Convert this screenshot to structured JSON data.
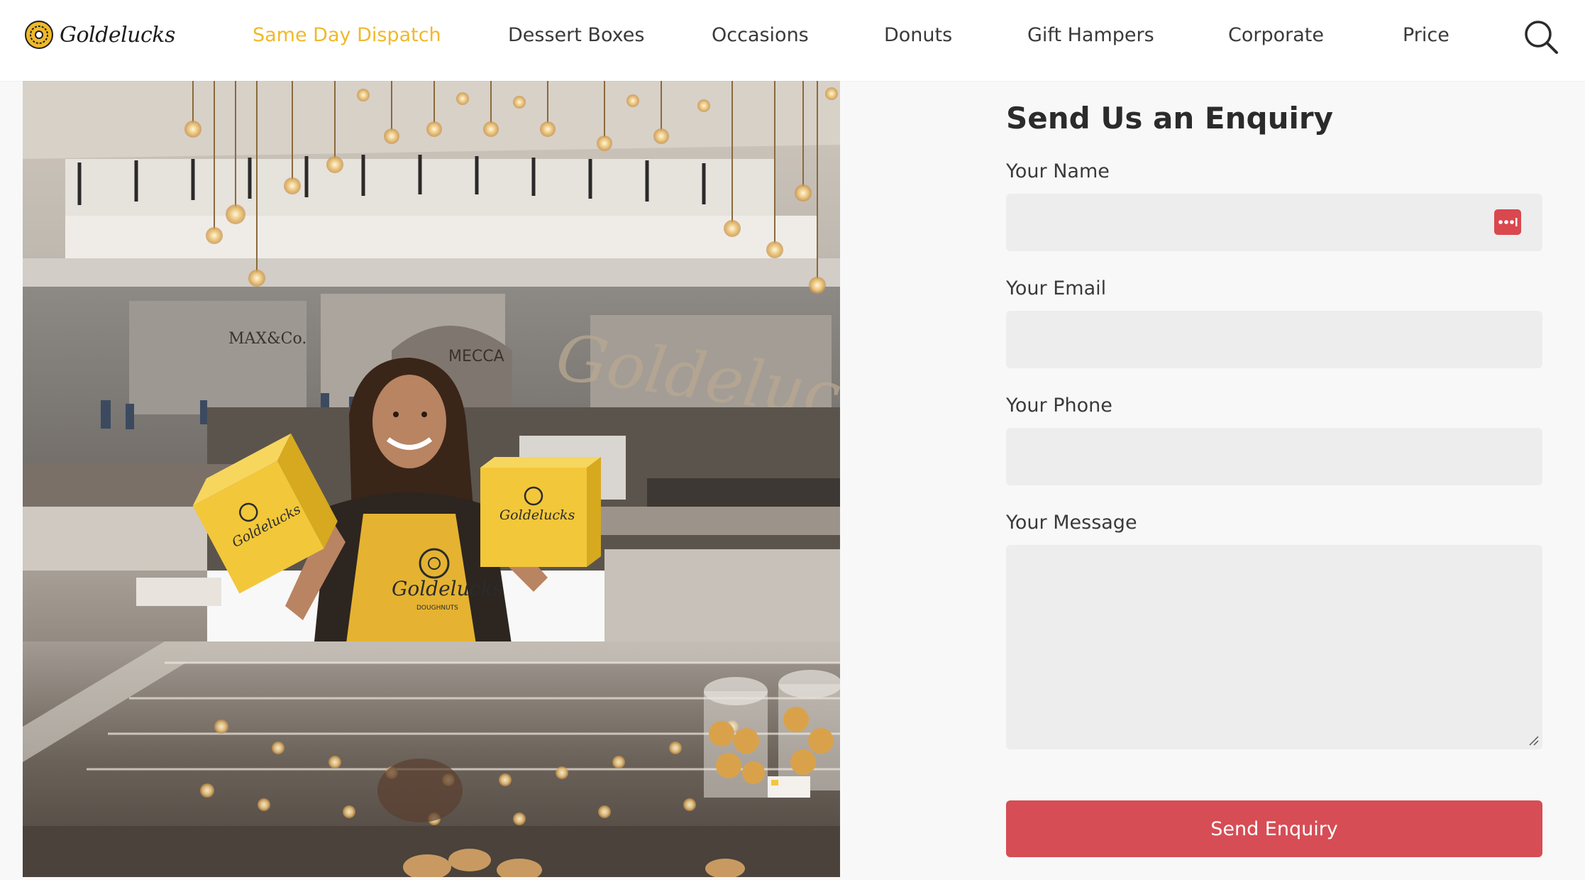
{
  "brand": {
    "name": "Goldelucks"
  },
  "nav": {
    "items": [
      {
        "label": "Same Day Dispatch",
        "active": true
      },
      {
        "label": "Dessert Boxes",
        "active": false
      },
      {
        "label": "Occasions",
        "active": false
      },
      {
        "label": "Donuts",
        "active": false
      },
      {
        "label": "Gift Hampers",
        "active": false
      },
      {
        "label": "Corporate",
        "active": false
      },
      {
        "label": "Price",
        "active": false
      }
    ],
    "search_icon": "search-icon"
  },
  "photo": {
    "box_brand": "Goldelucks",
    "apron_brand": "Goldelucks",
    "apron_sub": "DOUGHNUTS",
    "store_signs": [
      "MAX&Co.",
      "MECCA",
      "Goldelucks"
    ]
  },
  "form": {
    "title": "Send Us an Enquiry",
    "fields": {
      "name": {
        "label": "Your Name",
        "value": "",
        "placeholder": ""
      },
      "email": {
        "label": "Your Email",
        "value": "",
        "placeholder": ""
      },
      "phone": {
        "label": "Your Phone",
        "value": "",
        "placeholder": ""
      },
      "message": {
        "label": "Your Message",
        "value": "",
        "placeholder": ""
      }
    },
    "submit_label": "Send Enquiry",
    "password_manager_icon": "password-manager-icon"
  },
  "colors": {
    "accent_yellow": "#f0b92a",
    "button_red": "#d64d55",
    "input_bg": "#ededed",
    "text_dark": "#2b2b2b"
  }
}
